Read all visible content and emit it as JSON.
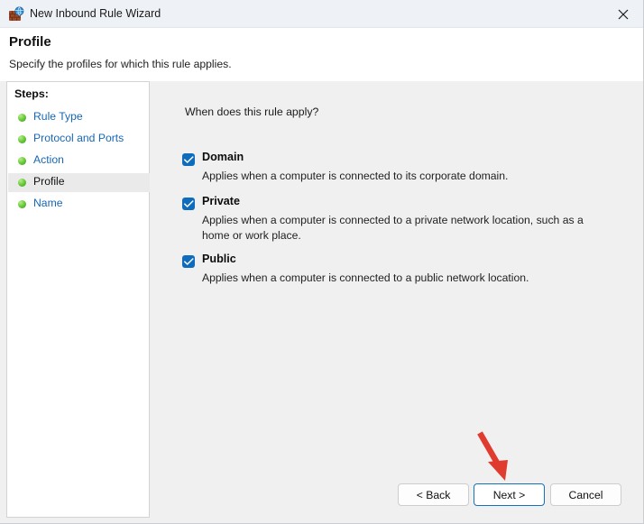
{
  "window": {
    "title": "New Inbound Rule Wizard",
    "icon": "firewall-globe-icon",
    "close_label": "close-icon"
  },
  "header": {
    "title": "Profile",
    "subtitle": "Specify the profiles for which this rule applies."
  },
  "sidebar": {
    "heading": "Steps:",
    "items": [
      {
        "label": "Rule Type",
        "current": false
      },
      {
        "label": "Protocol and Ports",
        "current": false
      },
      {
        "label": "Action",
        "current": false
      },
      {
        "label": "Profile",
        "current": true
      },
      {
        "label": "Name",
        "current": false
      }
    ]
  },
  "main": {
    "question": "When does this rule apply?",
    "profiles": [
      {
        "name": "Domain",
        "description": "Applies when a computer is connected to its corporate domain.",
        "checked": true
      },
      {
        "name": "Private",
        "description": "Applies when a computer is connected to a private network location, such as a home or work place.",
        "checked": true
      },
      {
        "name": "Public",
        "description": "Applies when a computer is connected to a public network location.",
        "checked": true
      }
    ]
  },
  "footer": {
    "back_label": "< Back",
    "next_label": "Next >",
    "cancel_label": "Cancel"
  },
  "annotation": {
    "arrow_color": "#e03b2f",
    "points_to": "Next >"
  },
  "colors": {
    "accent": "#0f6cbd",
    "focus_border": "#1272ba",
    "link": "#1667b5",
    "titlebar_bg": "#eef1f6",
    "content_bg": "#f0f0f0",
    "sidebar_bg": "#ffffff",
    "step_current_bg": "#eaeaea"
  }
}
